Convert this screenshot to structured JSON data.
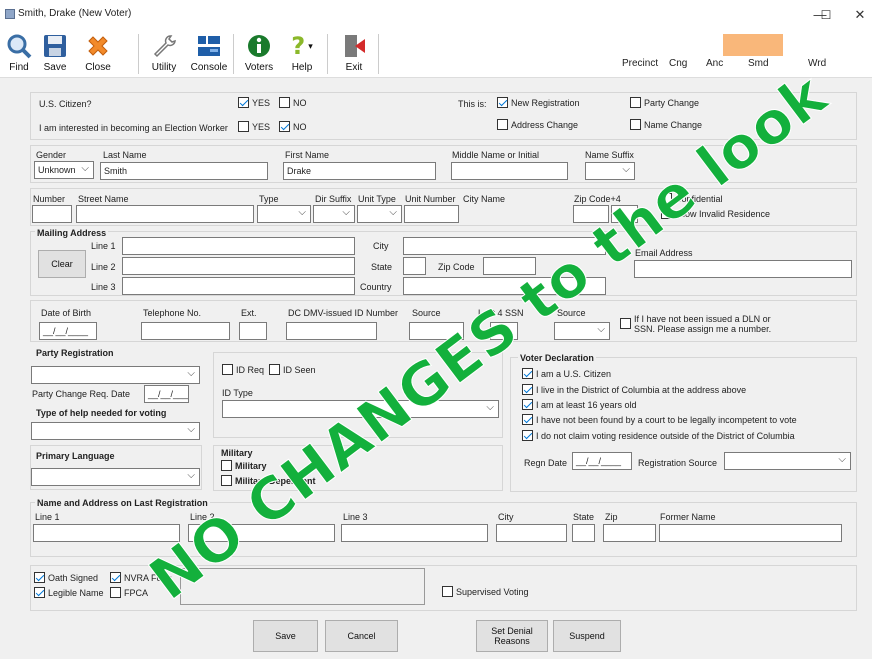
{
  "window": {
    "title": "Smith, Drake (New Voter)",
    "min": "—",
    "max": "☐",
    "close": "✕"
  },
  "toolbar": {
    "find": "Find",
    "save": "Save",
    "close": "Close",
    "utility": "Utility",
    "console": "Console",
    "voters": "Voters",
    "help": "Help",
    "exit": "Exit"
  },
  "header_fields": {
    "precinct": "Precinct",
    "cng": "Cng",
    "anc": "Anc",
    "smd": "Smd",
    "wrd": "Wrd"
  },
  "status": {
    "citizen_q": "U.S. Citizen?",
    "yes": "YES",
    "no": "NO",
    "election_worker_q": "I am interested in becoming an Election Worker",
    "this_is": "This is:",
    "new_registration": "New Registration",
    "party_change": "Party Change",
    "address_change": "Address Change",
    "name_change": "Name Change"
  },
  "name": {
    "gender_label": "Gender",
    "gender_value": "Unknown",
    "last_label": "Last Name",
    "last_value": "Smith",
    "first_label": "First Name",
    "first_value": "Drake",
    "middle_label": "Middle Name or Initial",
    "suffix_label": "Name Suffix"
  },
  "residence": {
    "number": "Number",
    "street": "Street Name",
    "type": "Type",
    "dir_suffix": "Dir Suffix",
    "unit_type": "Unit Type",
    "unit_number": "Unit Number",
    "city": "City Name",
    "zip": "Zip Code+4",
    "confidential": "Confidential",
    "allow_invalid": "Allow Invalid Residence"
  },
  "mailing": {
    "title": "Mailing Address",
    "clear": "Clear",
    "line1": "Line 1",
    "line2": "Line 2",
    "line3": "Line 3",
    "city": "City",
    "state": "State",
    "zip": "Zip Code",
    "country": "Country",
    "email": "Email Address"
  },
  "ids": {
    "dob": "Date of Birth",
    "dob_value": "__/__/____",
    "phone": "Telephone No.",
    "ext": "Ext.",
    "dmv": "DC DMV-issued ID Number",
    "source": "Source",
    "last4": "Last 4 SSN",
    "source2": "Source",
    "no_dln": "If I have not been issued a DLN or SSN. Please assign me a number."
  },
  "party": {
    "title": "Party Registration",
    "change_date": "Party Change Req. Date",
    "change_date_value": "__/__/____"
  },
  "help": {
    "title": "Type of help needed for voting"
  },
  "language": {
    "title": "Primary Language"
  },
  "idreq": {
    "id_req": "ID Req",
    "id_seen": "ID Seen",
    "id_type": "ID Type"
  },
  "military": {
    "title": "Military",
    "military": "Military",
    "dependent": "Military Dependent"
  },
  "declaration": {
    "title": "Voter Declaration",
    "items": [
      "I am a U.S. Citizen",
      "I live in the District of Columbia at the address above",
      "I am at least 16 years old",
      "I have not been found by a court to be legally incompetent to vote",
      "I do not claim voting residence outside of the District of Columbia"
    ],
    "regn_date": "Regn Date",
    "regn_date_value": "__/__/____",
    "regn_source": "Registration Source"
  },
  "last_reg": {
    "title": "Name and Address on Last Registration",
    "line1": "Line 1",
    "line2": "Line 2",
    "line3": "Line 3",
    "city": "City",
    "state": "State",
    "zip": "Zip",
    "former": "Former Name"
  },
  "bottom": {
    "oath": "Oath Signed",
    "nvra": "NVRA Form",
    "legible": "Legible Name",
    "fpca": "FPCA",
    "supervised": "Supervised Voting"
  },
  "actions": {
    "save": "Save",
    "cancel": "Cancel",
    "denial": "Set Denial Reasons",
    "suspend": "Suspend"
  },
  "watermark": "NO CHANGES to the look",
  "colors": {
    "watermark": "#13b03c",
    "highlight": "#f9b77a",
    "check": "#0078d7"
  }
}
